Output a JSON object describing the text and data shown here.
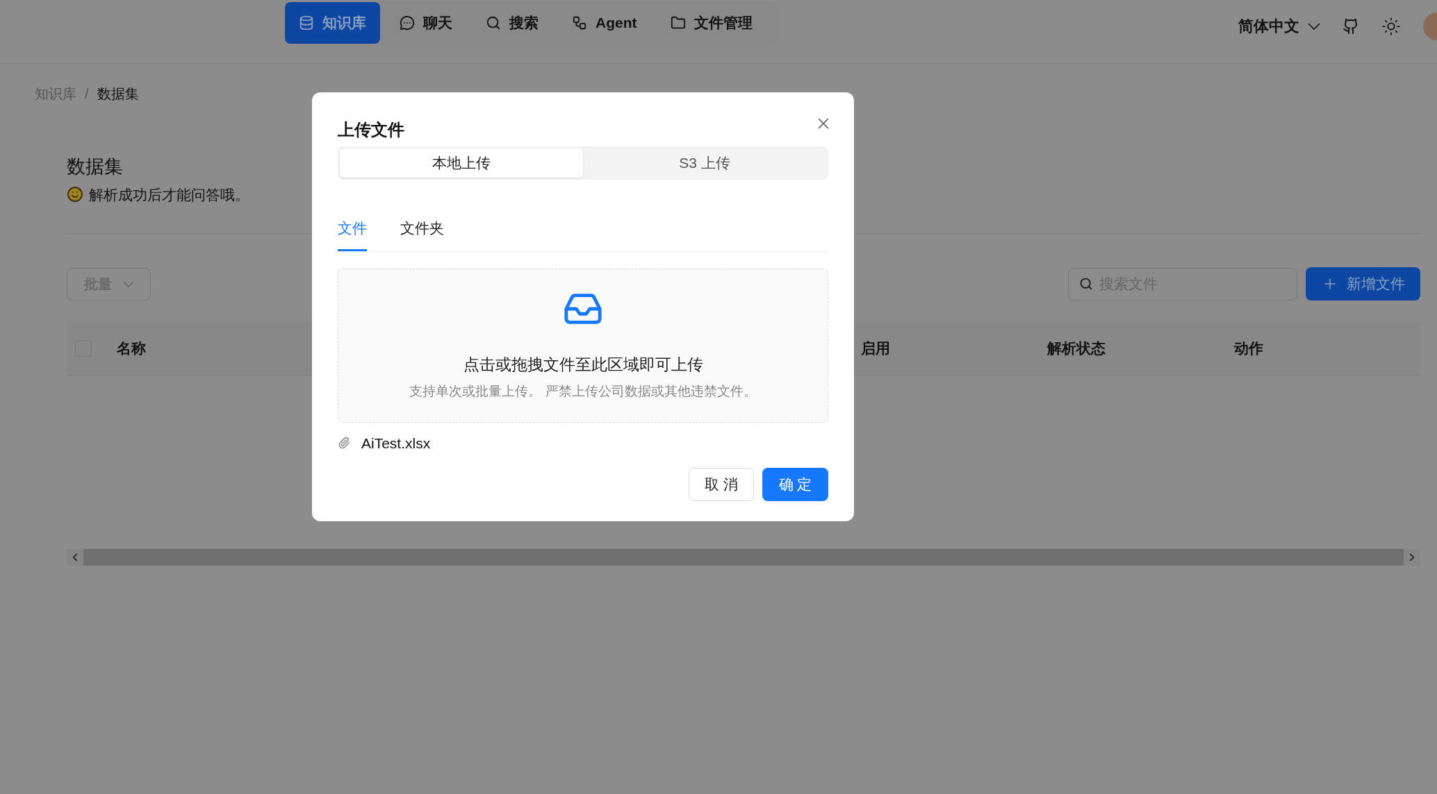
{
  "nav": {
    "items": [
      {
        "label": "知识库",
        "selected": true
      },
      {
        "label": "聊天",
        "selected": false
      },
      {
        "label": "搜索",
        "selected": false
      },
      {
        "label": "Agent",
        "selected": false
      },
      {
        "label": "文件管理",
        "selected": false
      }
    ],
    "language": "简体中文"
  },
  "breadcrumb": {
    "items": [
      "知识库",
      "数据集"
    ],
    "separator": "/"
  },
  "header": {
    "title": "数据集",
    "description": "解析成功后才能问答哦。"
  },
  "toolbar": {
    "bulk_button": "批量",
    "search": {
      "placeholder": "搜索文件"
    },
    "add_button": "新增文件"
  },
  "table": {
    "select_all": {
      "checked": false
    },
    "columns": [
      {
        "label": "名称"
      },
      {
        "label": "启用"
      },
      {
        "label": "解析状态"
      },
      {
        "label": "动作"
      }
    ]
  },
  "dialog": {
    "title": "上传文件",
    "sources": [
      {
        "label": "本地上传",
        "selected": true
      },
      {
        "label": "S3 上传",
        "selected": false
      }
    ],
    "tabs": [
      {
        "label": "文件",
        "selected": true
      },
      {
        "label": "文件夹",
        "selected": false
      }
    ],
    "dropzone": {
      "title": "点击或拖拽文件至此区域即可上传",
      "hint": "支持单次或批量上传。 严禁上传公司数据或其他违禁文件。"
    },
    "files": [
      {
        "name": "AiTest.xlsx"
      }
    ],
    "cancel": "取 消",
    "ok": "确 定"
  }
}
